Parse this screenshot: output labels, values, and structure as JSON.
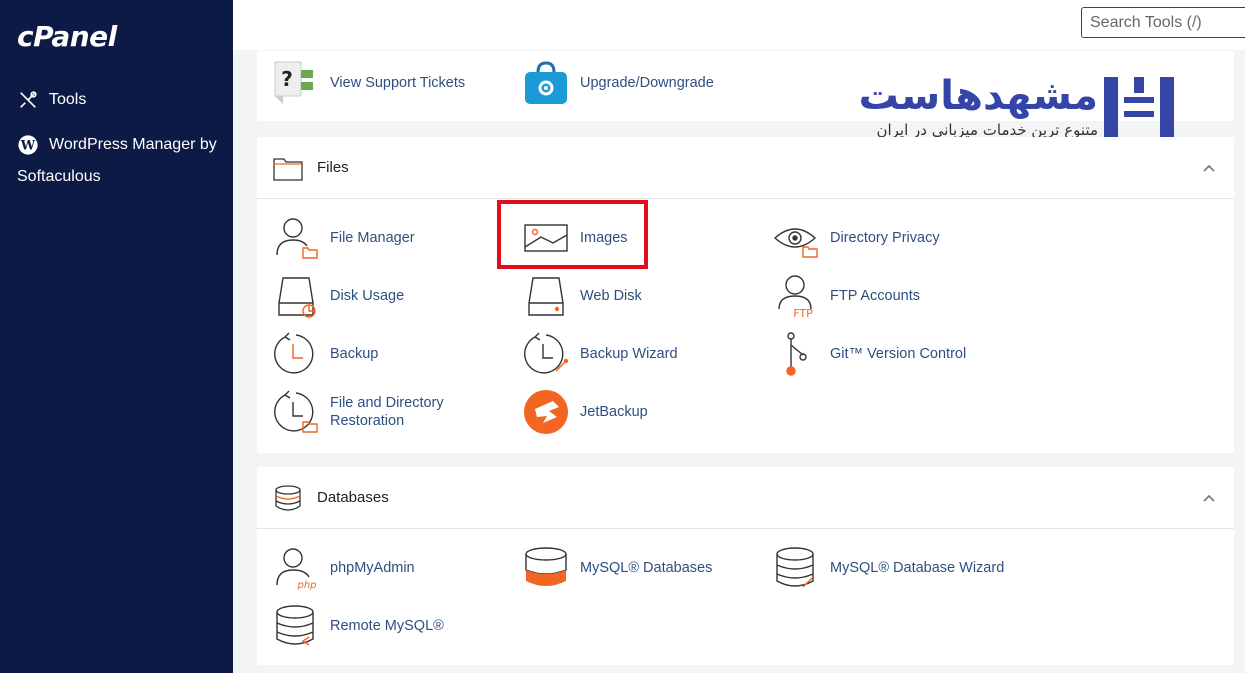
{
  "sidebar": {
    "logo": "cPanel",
    "items": [
      {
        "label": "Tools",
        "icon": "tools-icon"
      },
      {
        "label": "WordPress Manager by Softaculous",
        "icon": "wordpress-icon"
      }
    ]
  },
  "header": {
    "search_placeholder": "Search Tools (/)"
  },
  "top_section": {
    "items": [
      {
        "label": "View Support Tickets",
        "icon": "support-tickets-icon"
      },
      {
        "label": "Upgrade/Downgrade",
        "icon": "upgrade-bag-icon"
      }
    ]
  },
  "files": {
    "title": "Files",
    "items": [
      {
        "label": "File Manager",
        "icon": "file-manager-icon"
      },
      {
        "label": "Images",
        "icon": "images-icon"
      },
      {
        "label": "Directory Privacy",
        "icon": "directory-privacy-icon"
      },
      {
        "label": "Disk Usage",
        "icon": "disk-usage-icon"
      },
      {
        "label": "Web Disk",
        "icon": "web-disk-icon"
      },
      {
        "label": "FTP Accounts",
        "icon": "ftp-accounts-icon"
      },
      {
        "label": "Backup",
        "icon": "backup-icon"
      },
      {
        "label": "Backup Wizard",
        "icon": "backup-wizard-icon"
      },
      {
        "label": "Git™ Version Control",
        "icon": "git-icon"
      },
      {
        "label": "File and Directory Restoration",
        "icon": "restoration-icon"
      },
      {
        "label": "JetBackup",
        "icon": "jetbackup-icon"
      }
    ]
  },
  "databases": {
    "title": "Databases",
    "items": [
      {
        "label": "phpMyAdmin",
        "icon": "phpmyadmin-icon"
      },
      {
        "label": "MySQL® Databases",
        "icon": "mysql-databases-icon"
      },
      {
        "label": "MySQL® Database Wizard",
        "icon": "mysql-wizard-icon"
      },
      {
        "label": "Remote MySQL®",
        "icon": "remote-mysql-icon"
      }
    ]
  },
  "brand": {
    "name": "مشهدهاست",
    "tagline": "متنوع ترین خدمات میزبانی در ایران"
  },
  "colors": {
    "sidebar": "#0d1a45",
    "link": "#2f4f80",
    "accent_orange": "#f26522",
    "highlight": "#e30e1b",
    "brand_blue": "#3545a7"
  }
}
